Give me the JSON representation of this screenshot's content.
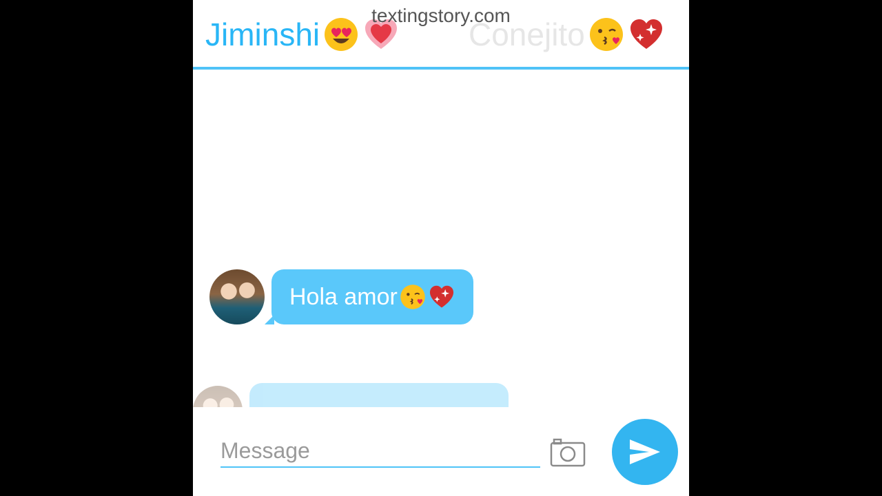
{
  "watermark": "textingstory.com",
  "header": {
    "tabs": [
      {
        "label": "Jiminshi",
        "emojis": [
          "heart-eyes-face-icon",
          "pink-heart-icon"
        ]
      },
      {
        "label": "Conejito",
        "emojis": [
          "kiss-face-icon",
          "sparkling-heart-icon"
        ]
      }
    ],
    "active_tab": 0
  },
  "messages": [
    {
      "text": "Hola amor",
      "emojis": [
        "kiss-face-icon",
        "sparkling-heart-icon"
      ]
    },
    {
      "text": "",
      "emojis": []
    }
  ],
  "input": {
    "placeholder": "Message",
    "value": ""
  },
  "colors": {
    "accent": "#4fc3f7",
    "bubble": "#5ac8fa",
    "send": "#33b5f0"
  }
}
